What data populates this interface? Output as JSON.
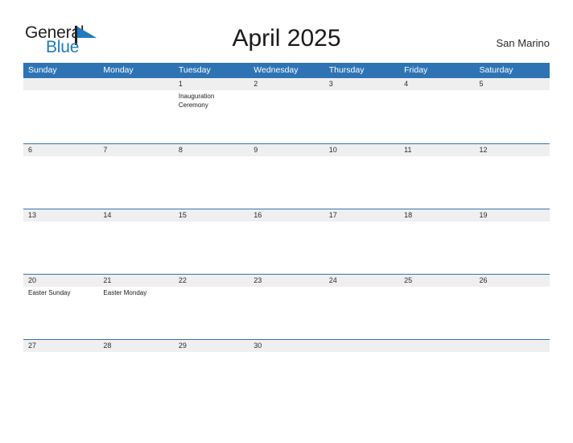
{
  "brand": {
    "name_part1": "General",
    "name_part2": "Blue",
    "logo_icon": "triangle-flag-mark",
    "accent_color": "#1f7ac1"
  },
  "header": {
    "title": "April 2025",
    "location": "San Marino"
  },
  "theme": {
    "header_blue": "#2e74b5",
    "band_gray": "#efefef",
    "text_dark": "#1a1a1a",
    "page_background": "#ffffff"
  },
  "calendar": {
    "month": "April",
    "year": "2025",
    "weekday_headers": [
      "Sunday",
      "Monday",
      "Tuesday",
      "Wednesday",
      "Thursday",
      "Friday",
      "Saturday"
    ],
    "weeks": [
      [
        {
          "date": "",
          "events": []
        },
        {
          "date": "",
          "events": []
        },
        {
          "date": "1",
          "events": [
            "Inauguration Ceremony"
          ]
        },
        {
          "date": "2",
          "events": []
        },
        {
          "date": "3",
          "events": []
        },
        {
          "date": "4",
          "events": []
        },
        {
          "date": "5",
          "events": []
        }
      ],
      [
        {
          "date": "6",
          "events": []
        },
        {
          "date": "7",
          "events": []
        },
        {
          "date": "8",
          "events": []
        },
        {
          "date": "9",
          "events": []
        },
        {
          "date": "10",
          "events": []
        },
        {
          "date": "11",
          "events": []
        },
        {
          "date": "12",
          "events": []
        }
      ],
      [
        {
          "date": "13",
          "events": []
        },
        {
          "date": "14",
          "events": []
        },
        {
          "date": "15",
          "events": []
        },
        {
          "date": "16",
          "events": []
        },
        {
          "date": "17",
          "events": []
        },
        {
          "date": "18",
          "events": []
        },
        {
          "date": "19",
          "events": []
        }
      ],
      [
        {
          "date": "20",
          "events": [
            "Easter Sunday"
          ]
        },
        {
          "date": "21",
          "events": [
            "Easter Monday"
          ]
        },
        {
          "date": "22",
          "events": []
        },
        {
          "date": "23",
          "events": []
        },
        {
          "date": "24",
          "events": []
        },
        {
          "date": "25",
          "events": []
        },
        {
          "date": "26",
          "events": []
        }
      ],
      [
        {
          "date": "27",
          "events": []
        },
        {
          "date": "28",
          "events": []
        },
        {
          "date": "29",
          "events": []
        },
        {
          "date": "30",
          "events": []
        },
        {
          "date": "",
          "events": []
        },
        {
          "date": "",
          "events": []
        },
        {
          "date": "",
          "events": []
        }
      ]
    ]
  }
}
